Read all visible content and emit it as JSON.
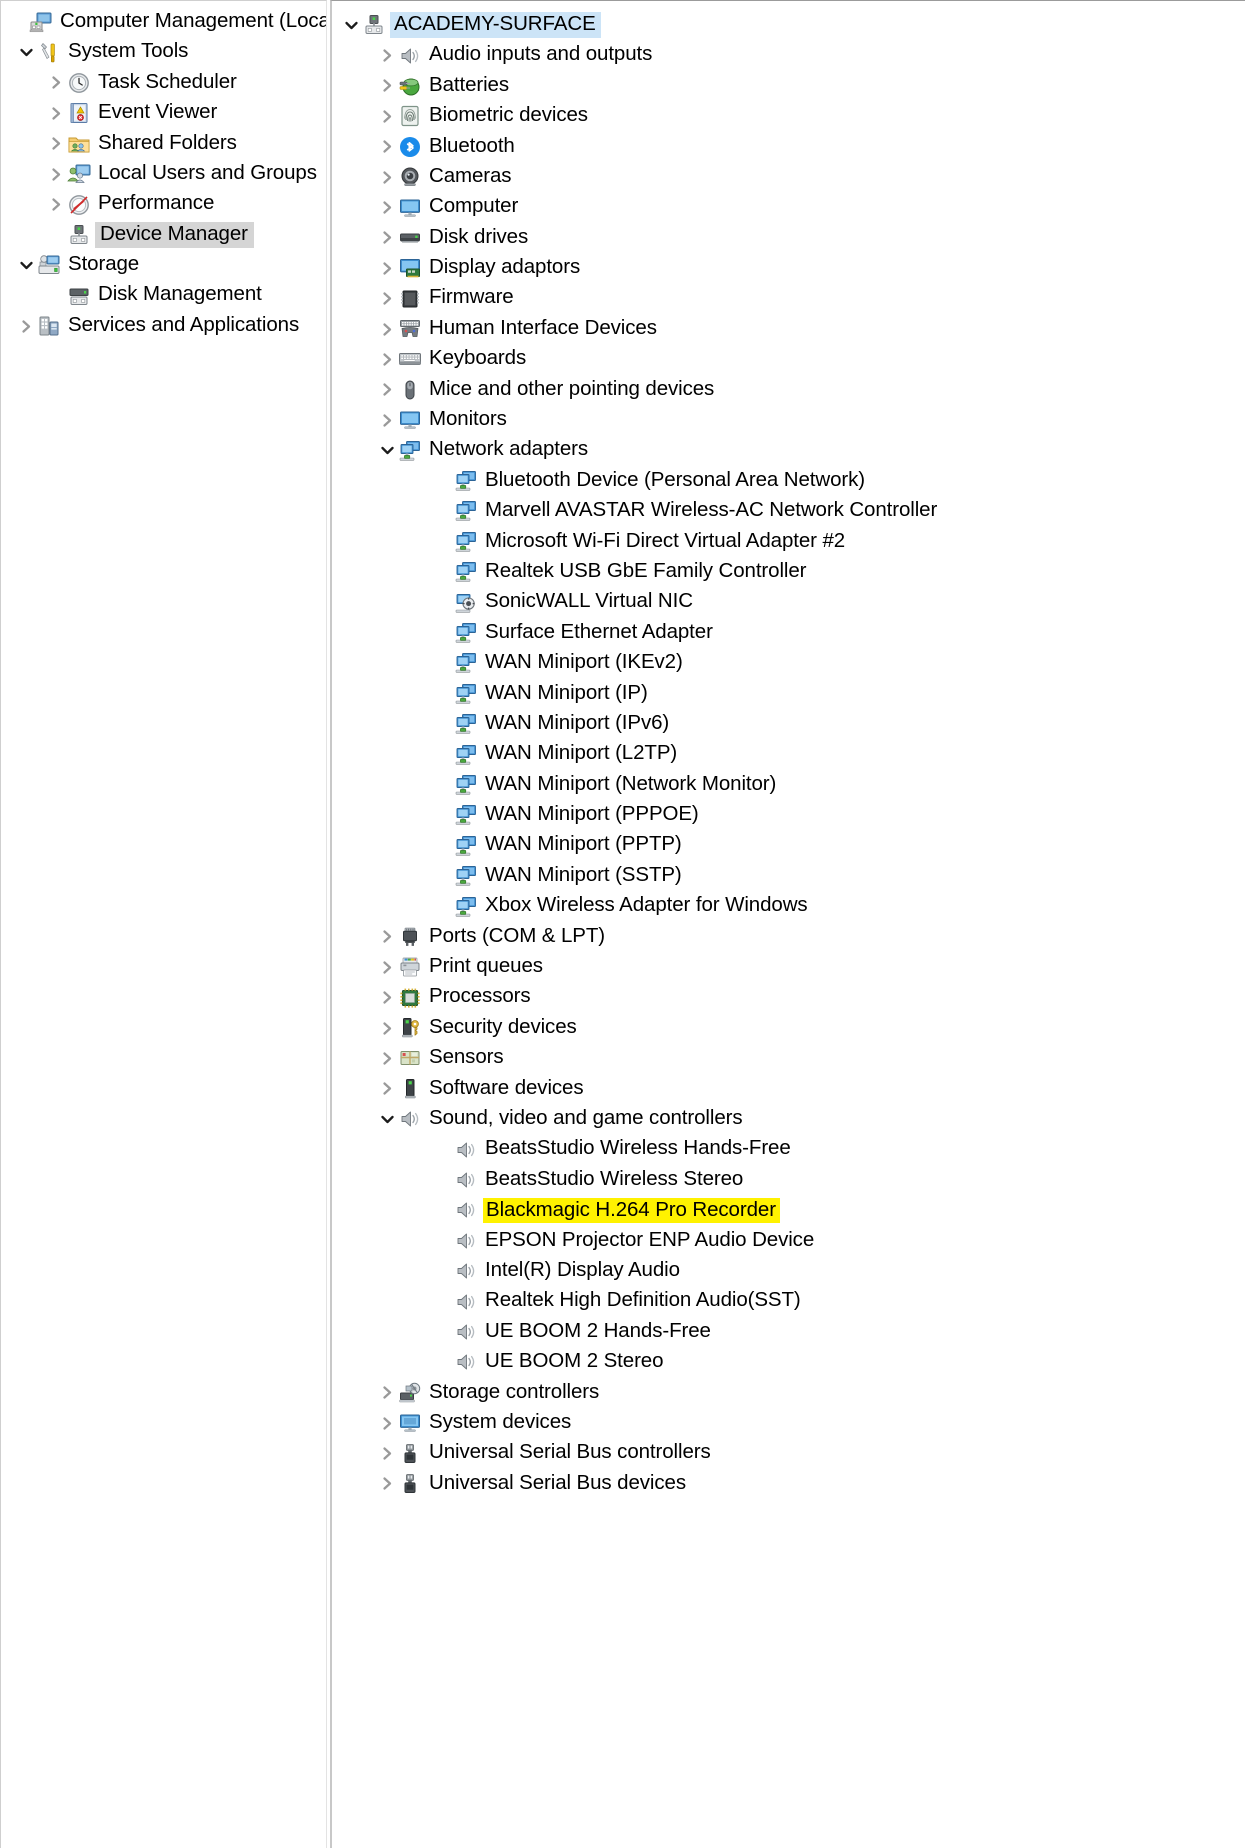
{
  "window": {
    "title": "Computer Management (Local)"
  },
  "console_tree": {
    "root": {
      "label": "Computer Management (Local)",
      "icon": "computer-management-icon",
      "expanded": true
    },
    "items": [
      {
        "label": "System Tools",
        "icon": "system-tools-icon",
        "state": "expanded",
        "level": 1
      },
      {
        "label": "Task Scheduler",
        "icon": "clock-icon",
        "state": "collapsed",
        "level": 2
      },
      {
        "label": "Event Viewer",
        "icon": "event-viewer-icon",
        "state": "collapsed",
        "level": 2
      },
      {
        "label": "Shared Folders",
        "icon": "shared-folders-icon",
        "state": "collapsed",
        "level": 2
      },
      {
        "label": "Local Users and Groups",
        "icon": "users-groups-icon",
        "state": "collapsed",
        "level": 2
      },
      {
        "label": "Performance",
        "icon": "performance-icon",
        "state": "collapsed",
        "level": 2
      },
      {
        "label": "Device Manager",
        "icon": "device-manager-icon",
        "state": "selected",
        "level": 2
      },
      {
        "label": "Storage",
        "icon": "storage-icon",
        "state": "expanded",
        "level": 1
      },
      {
        "label": "Disk Management",
        "icon": "disk-management-icon",
        "state": "leaf",
        "level": 2
      },
      {
        "label": "Services and Applications",
        "icon": "services-applications-icon",
        "state": "collapsed",
        "level": 1
      }
    ]
  },
  "device_tree": {
    "root": {
      "label": "ACADEMY-SURFACE",
      "icon": "computer-node-icon",
      "state": "expanded-selected"
    },
    "nodes": [
      {
        "label": "Audio inputs and outputs",
        "icon": "speaker-icon",
        "state": "collapsed",
        "level": 1
      },
      {
        "label": "Batteries",
        "icon": "battery-icon",
        "state": "collapsed",
        "level": 1
      },
      {
        "label": "Biometric devices",
        "icon": "fingerprint-icon",
        "state": "collapsed",
        "level": 1
      },
      {
        "label": "Bluetooth",
        "icon": "bluetooth-icon",
        "state": "collapsed",
        "level": 1
      },
      {
        "label": "Cameras",
        "icon": "camera-icon",
        "state": "collapsed",
        "level": 1
      },
      {
        "label": "Computer",
        "icon": "monitor-icon",
        "state": "collapsed",
        "level": 1
      },
      {
        "label": "Disk drives",
        "icon": "disk-drive-icon",
        "state": "collapsed",
        "level": 1
      },
      {
        "label": "Display adaptors",
        "icon": "display-adapter-icon",
        "state": "collapsed",
        "level": 1
      },
      {
        "label": "Firmware",
        "icon": "chip-icon",
        "state": "collapsed",
        "level": 1
      },
      {
        "label": "Human Interface Devices",
        "icon": "hid-icon",
        "state": "collapsed",
        "level": 1
      },
      {
        "label": "Keyboards",
        "icon": "keyboard-icon",
        "state": "collapsed",
        "level": 1
      },
      {
        "label": "Mice and other pointing devices",
        "icon": "mouse-icon",
        "state": "collapsed",
        "level": 1
      },
      {
        "label": "Monitors",
        "icon": "monitor-icon",
        "state": "collapsed",
        "level": 1
      },
      {
        "label": "Network adapters",
        "icon": "network-adapter-icon",
        "state": "expanded",
        "level": 1
      },
      {
        "label": "Bluetooth Device (Personal Area Network)",
        "icon": "network-adapter-icon",
        "state": "leaf",
        "level": 2
      },
      {
        "label": "Marvell AVASTAR Wireless-AC Network Controller",
        "icon": "network-adapter-icon",
        "state": "leaf",
        "level": 2
      },
      {
        "label": "Microsoft Wi-Fi Direct Virtual Adapter #2",
        "icon": "network-adapter-icon",
        "state": "leaf",
        "level": 2
      },
      {
        "label": "Realtek USB GbE Family Controller",
        "icon": "network-adapter-icon",
        "state": "leaf",
        "level": 2
      },
      {
        "label": "SonicWALL Virtual NIC",
        "icon": "virtual-nic-icon",
        "state": "leaf",
        "level": 2
      },
      {
        "label": "Surface Ethernet Adapter",
        "icon": "network-adapter-icon",
        "state": "leaf",
        "level": 2
      },
      {
        "label": "WAN Miniport (IKEv2)",
        "icon": "network-adapter-icon",
        "state": "leaf",
        "level": 2
      },
      {
        "label": "WAN Miniport (IP)",
        "icon": "network-adapter-icon",
        "state": "leaf",
        "level": 2
      },
      {
        "label": "WAN Miniport (IPv6)",
        "icon": "network-adapter-icon",
        "state": "leaf",
        "level": 2
      },
      {
        "label": "WAN Miniport (L2TP)",
        "icon": "network-adapter-icon",
        "state": "leaf",
        "level": 2
      },
      {
        "label": "WAN Miniport (Network Monitor)",
        "icon": "network-adapter-icon",
        "state": "leaf",
        "level": 2
      },
      {
        "label": "WAN Miniport (PPPOE)",
        "icon": "network-adapter-icon",
        "state": "leaf",
        "level": 2
      },
      {
        "label": "WAN Miniport (PPTP)",
        "icon": "network-adapter-icon",
        "state": "leaf",
        "level": 2
      },
      {
        "label": "WAN Miniport (SSTP)",
        "icon": "network-adapter-icon",
        "state": "leaf",
        "level": 2
      },
      {
        "label": "Xbox Wireless Adapter for Windows",
        "icon": "network-adapter-icon",
        "state": "leaf",
        "level": 2
      },
      {
        "label": "Ports (COM & LPT)",
        "icon": "port-icon",
        "state": "collapsed",
        "level": 1
      },
      {
        "label": "Print queues",
        "icon": "printer-icon",
        "state": "collapsed",
        "level": 1
      },
      {
        "label": "Processors",
        "icon": "processor-icon",
        "state": "collapsed",
        "level": 1
      },
      {
        "label": "Security devices",
        "icon": "security-device-icon",
        "state": "collapsed",
        "level": 1
      },
      {
        "label": "Sensors",
        "icon": "sensor-icon",
        "state": "collapsed",
        "level": 1
      },
      {
        "label": "Software devices",
        "icon": "software-device-icon",
        "state": "collapsed",
        "level": 1
      },
      {
        "label": "Sound, video and game controllers",
        "icon": "speaker-icon",
        "state": "expanded",
        "level": 1
      },
      {
        "label": "BeatsStudio Wireless Hands-Free",
        "icon": "speaker-icon",
        "state": "leaf",
        "level": 2
      },
      {
        "label": "BeatsStudio Wireless Stereo",
        "icon": "speaker-icon",
        "state": "leaf",
        "level": 2
      },
      {
        "label": "Blackmagic H.264 Pro Recorder",
        "icon": "speaker-icon",
        "state": "leaf-highlighted",
        "level": 2
      },
      {
        "label": "EPSON Projector ENP Audio Device",
        "icon": "speaker-icon",
        "state": "leaf",
        "level": 2
      },
      {
        "label": "Intel(R) Display Audio",
        "icon": "speaker-icon",
        "state": "leaf",
        "level": 2
      },
      {
        "label": "Realtek High Definition Audio(SST)",
        "icon": "speaker-icon",
        "state": "leaf",
        "level": 2
      },
      {
        "label": "UE BOOM 2 Hands-Free",
        "icon": "speaker-icon",
        "state": "leaf",
        "level": 2
      },
      {
        "label": "UE BOOM 2 Stereo",
        "icon": "speaker-icon",
        "state": "leaf",
        "level": 2
      },
      {
        "label": "Storage controllers",
        "icon": "storage-controller-icon",
        "state": "collapsed",
        "level": 1
      },
      {
        "label": "System devices",
        "icon": "system-device-icon",
        "state": "collapsed",
        "level": 1
      },
      {
        "label": "Universal Serial Bus controllers",
        "icon": "usb-icon",
        "state": "collapsed",
        "level": 1
      },
      {
        "label": "Universal Serial Bus devices",
        "icon": "usb-device-icon",
        "state": "collapsed",
        "level": 1
      }
    ]
  },
  "colors": {
    "selection_blue": "#cce4f7",
    "selection_gray": "#d5d5d5",
    "highlight_yellow": "#fff200",
    "twisty_gray": "#8c8c8c"
  }
}
